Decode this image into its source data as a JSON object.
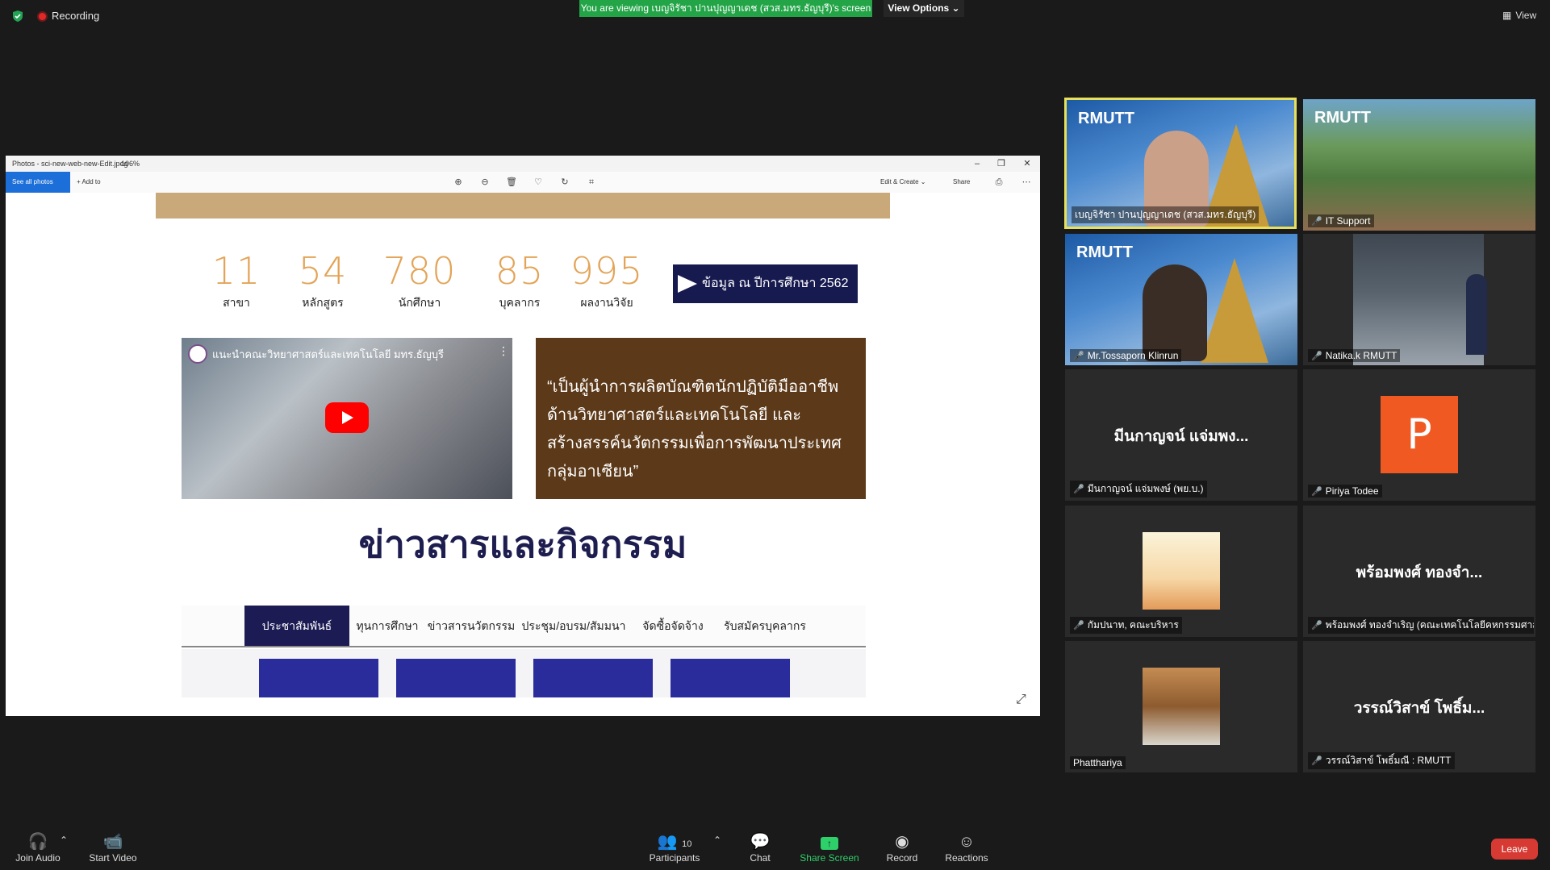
{
  "topbar": {
    "recording_label": "Recording",
    "share_banner": "You are viewing เบญจิรัชา ปานปุญญาเดช (สวส.มทร.ธัญบุรี)'s screen",
    "view_options": "View Options ⌄",
    "view_label": "View"
  },
  "window": {
    "title": "Photos - sci-new-web-new-Edit.jpeg",
    "zoom": "106%",
    "see_all_photos": "See all photos",
    "add_to": "+ Add to",
    "edit_create": "Edit & Create ⌄",
    "share": "Share"
  },
  "page": {
    "stats": [
      {
        "num": "11",
        "label": "สาขา"
      },
      {
        "num": "54",
        "label": "หลักสูตร"
      },
      {
        "num": "780",
        "label": "นักศึกษา"
      },
      {
        "num": "85",
        "label": "บุคลากร"
      },
      {
        "num": "995",
        "label": "ผลงานวิจัย"
      }
    ],
    "data_badge": "ข้อมูล ณ ปีการศึกษา 2562",
    "video_title": "แนะนำคณะวิทยาศาสตร์และเทคโนโลยี มทร.ธัญบุรี",
    "vision": "“เป็นผู้นำการผลิตบัณฑิตนักปฏิบัติมืออาชีพ ด้านวิทยาศาสตร์และเทคโนโลยี และสร้างสรรค์นวัตกรรมเพื่อการพัฒนาประเทศกลุ่มอาเซียน”",
    "news_heading": "ข่าวสารและกิจกรรม",
    "tabs": [
      "ประชาสัมพันธ์",
      "ทุนการศึกษา",
      "ข่าวสารนวัตกรรม",
      "ประชุม/อบรม/สัมมนา",
      "จัดซื้อจัดจ้าง",
      "รับสมัครบุคลากร"
    ]
  },
  "gallery": {
    "tiles": [
      {
        "name": "เบญจิรัชา ปานปุญญาเดช (สวส.มทร.ธัญบุรี)",
        "muted": false
      },
      {
        "name": "IT Support",
        "muted": true
      },
      {
        "name": "Mr.Tossaporn Klinrun",
        "muted": true
      },
      {
        "name": "Natika.k RMUTT",
        "muted": true
      },
      {
        "name": "มีนกาญจน์ แจ่มพงษ์ (พย.บ.)",
        "big": "มีนกาญจน์ แจ่มพง...",
        "muted": true
      },
      {
        "name": "Piriya Todee",
        "avatar": "P",
        "muted": true
      },
      {
        "name": "กัมปนาท, คณะบริหาร",
        "muted": true
      },
      {
        "name": "พร้อมพงศ์ ทองจำเริญ (คณะเทคโนโลยีคหกรรมศาสตร์)",
        "big": "พร้อมพงศ์ ทองจำ...",
        "muted": true
      },
      {
        "name": "Phatthariya",
        "muted": false
      },
      {
        "name": "วรรณ์วิสาข์ โพธิ์มณี : RMUTT",
        "big": "วรรณ์วิสาข์ โพธิ์ม...",
        "muted": true
      }
    ],
    "logo_text": "RMUTT"
  },
  "bottombar": {
    "join_audio": "Join Audio",
    "start_video": "Start Video",
    "participants": "Participants",
    "participants_count": "10",
    "chat": "Chat",
    "share_screen": "Share Screen",
    "record": "Record",
    "reactions": "Reactions",
    "leave": "Leave"
  },
  "colors": {
    "zoom_green": "#22a447",
    "leave_red": "#d63a32",
    "stat_orange": "#e3a457",
    "navy": "#1c1b54",
    "vision_brown": "#5c3918"
  }
}
